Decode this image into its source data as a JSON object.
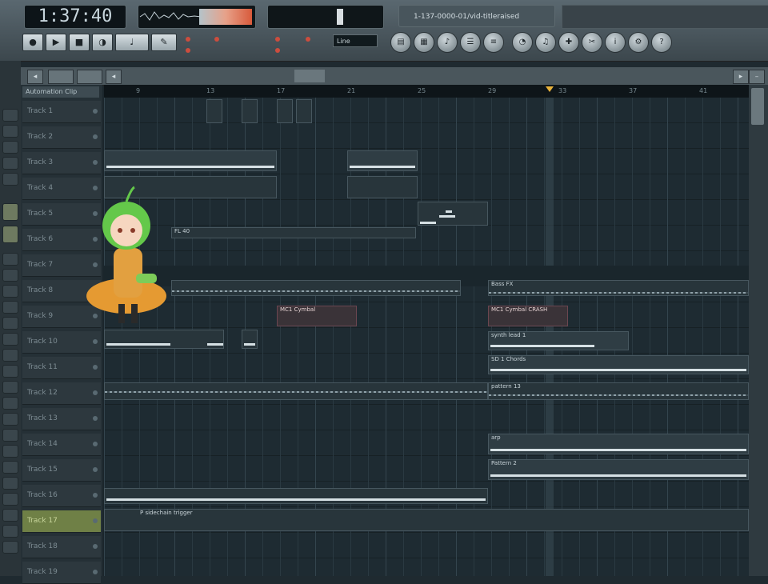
{
  "toolbar": {
    "time": "1:37:40",
    "song_title": "1-137-0000-01/vid-titleraised",
    "snap": "Line",
    "transport_buttons": [
      "rec-icon",
      "play-icon",
      "stop-icon",
      "pat-song-icon"
    ],
    "window_icons": [
      "playlist-icon",
      "stepseq-icon",
      "pianoroll-icon",
      "browser-icon",
      "mixer-icon"
    ],
    "tool_icons": [
      "cpu-icon",
      "tempo-icon",
      "plugin-icon",
      "tools-icon",
      "help-icon",
      "info-icon",
      "question-icon"
    ]
  },
  "playlist": {
    "pattern_tab": "Automation Clip",
    "bar_numbers": [
      "9",
      "13",
      "17",
      "21",
      "25",
      "29",
      "33",
      "37",
      "41"
    ],
    "tracks": [
      {
        "name": "Track 1"
      },
      {
        "name": "Track 2"
      },
      {
        "name": "Track 3"
      },
      {
        "name": "Track 4"
      },
      {
        "name": "Track 5"
      },
      {
        "name": "Track 6"
      },
      {
        "name": "Track 7"
      },
      {
        "name": "Track 8"
      },
      {
        "name": "Track 9"
      },
      {
        "name": "Track 10"
      },
      {
        "name": "Track 11"
      },
      {
        "name": "Track 12"
      },
      {
        "name": "Track 13"
      },
      {
        "name": "Track 14"
      },
      {
        "name": "Track 15"
      },
      {
        "name": "Track 16"
      },
      {
        "name": "Track 17"
      },
      {
        "name": "Track 18"
      },
      {
        "name": "Track 19"
      }
    ],
    "clips": {
      "fl40": "FL 40",
      "bass": "Bass FX",
      "vocal": "MC1 Cymbal",
      "vocal2": "MC1 Cymbal CRASH",
      "synth": "synth lead 1",
      "pad": "SD 1 Chords",
      "pattern": "pattern 13",
      "arp": "arp",
      "pattern2": "Pattern 2",
      "sidechain": "P sidechain trigger"
    }
  }
}
